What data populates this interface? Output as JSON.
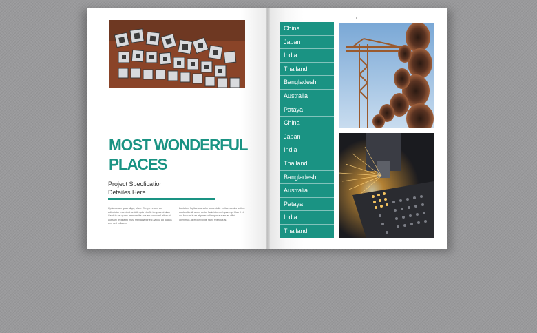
{
  "left_page": {
    "headline_line1": "MOST WONDERFUL",
    "headline_line2": "PLACES",
    "subtitle_line1": "Project Specfication",
    "subtitle_line2": "Detailes Here",
    "body_col1": "Uptia cusam quas aliqui, ulam. Et repe rerum, est adicabrice mun dent andotb quis et offic tempors ut alsur Genti te est quoss remnoenitis ace am volorum Uritem et aut sam reclibaxto mus. Mendallabor est aaliqui ad quatus am, sed millatem.",
    "body_col2": "Luptatum fugitae sus volor ucoientdite velitaecus alis antiore quidundia alit anem acitur facia intorued quam qui blab il et aut faccum in ex et porer velim quassusam as officil openimus as et dosvolute nam. relendus al."
  },
  "right_page": {
    "page_number": "7",
    "countries": [
      "China",
      "Japan",
      "India",
      "Thailand",
      "Bangladesh",
      "Australia",
      "Pataya",
      "China",
      "Japan",
      "India",
      "Thailand",
      "Bangladesh",
      "Australia",
      "Pataya",
      "India",
      "Thailand"
    ]
  },
  "colors": {
    "accent": "#1a9383",
    "background": "#9a9a9c"
  }
}
